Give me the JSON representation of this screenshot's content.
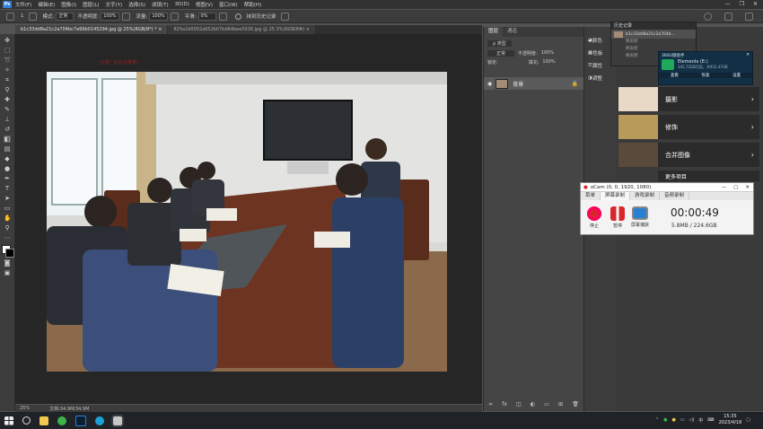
{
  "menubar": {
    "logo": "Ps",
    "items": [
      "文件(F)",
      "编辑(E)",
      "图像(I)",
      "图层(L)",
      "文字(Y)",
      "选择(S)",
      "滤镜(T)",
      "3D(D)",
      "视图(V)",
      "窗口(W)",
      "帮助(H)"
    ]
  },
  "options": {
    "brush_size": "1",
    "mode_label": "模式:",
    "mode_value": "正常",
    "opacity_label": "不透明度:",
    "opacity_value": "100%",
    "flow_label": "流量:",
    "flow_value": "100%",
    "smooth_label": "平滑:",
    "smooth_value": "0%",
    "history_checkbox_label": "抹到历史记录"
  },
  "tabs": [
    {
      "label": "b1c33dd8a21c2a704bc7a99b0145294.jpg @ 25%(RGB/8*) * ×"
    },
    {
      "label": "825a2d0002a652b07bd64bee5926.jpg @ 25.3%(RGB/8#) ×"
    }
  ],
  "canvas": {
    "red_note": "(注意：此处为背景)"
  },
  "status": {
    "zoom": "25%",
    "doc_info": "文档:34.9M/34.9M"
  },
  "layers_panel": {
    "tabs": [
      "图层",
      "通道"
    ],
    "kind_label": "ρ 类型",
    "blend": "正常",
    "opacity_label": "不透明度:",
    "opacity_value": "100%",
    "lock_label": "锁定:",
    "fill_label": "填充:",
    "fill_value": "100%",
    "layer_name": "背景"
  },
  "mini_panel": {
    "items": [
      "颜色",
      "色板",
      "属性",
      "调整"
    ]
  },
  "history_popup": {
    "title": "历史记录",
    "snapshot": "b1c33dd8a21c2a704b...",
    "steps": [
      "橡皮擦",
      "橡皮擦",
      "橡皮擦"
    ]
  },
  "scan_popup": {
    "title": "360U盘助手",
    "device": "Elements (E:)",
    "detail": "342.72GB可用，共931.47GB",
    "actions": [
      "查看",
      "恢复",
      "设置"
    ]
  },
  "library": {
    "cards": [
      "摄影",
      "修饰",
      "合并图像",
      "更多项目"
    ]
  },
  "ocam": {
    "title": "oCam (0, 0, 1920, 1080)",
    "tabs": [
      "菜单",
      "屏幕录制",
      "游戏录制",
      "音频录制"
    ],
    "stop_label": "停止",
    "pause_label": "暂停",
    "capture_label": "屏幕捕获",
    "timer": "00:00:49",
    "size": "5.8MB / 224.6GB"
  },
  "taskbar": {
    "time": "15:35",
    "date": "2023/4/18",
    "ime": "中"
  },
  "colors": {
    "ps_dark": "#323232",
    "panel": "#454545",
    "ocam_stop": "#d9262b",
    "ocam_pause": "#d9262b",
    "taskbar": "#1f2328"
  }
}
